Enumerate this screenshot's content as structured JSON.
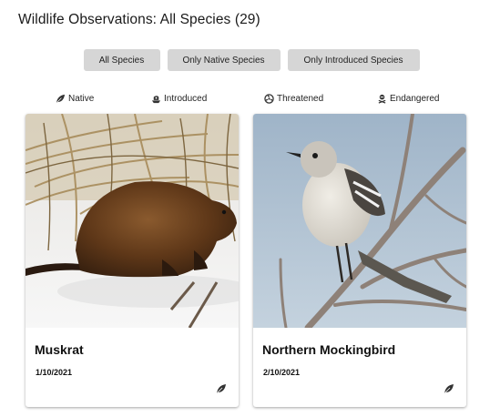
{
  "page": {
    "title": "Wildlife Observations: All Species (29)"
  },
  "filters": {
    "all": "All Species",
    "native": "Only Native Species",
    "introduced": "Only Introduced Species"
  },
  "legend": {
    "native": "Native",
    "introduced": "Introduced",
    "threatened": "Threatened",
    "endangered": "Endangered"
  },
  "cards": [
    {
      "name": "Muskrat",
      "date": "1/10/2021",
      "status_icon": "native-leaf-icon"
    },
    {
      "name": "Northern Mockingbird",
      "date": "2/10/2021",
      "status_icon": "native-leaf-icon"
    }
  ],
  "colors": {
    "button_bg": "#d6d6d6",
    "text": "#111111"
  }
}
